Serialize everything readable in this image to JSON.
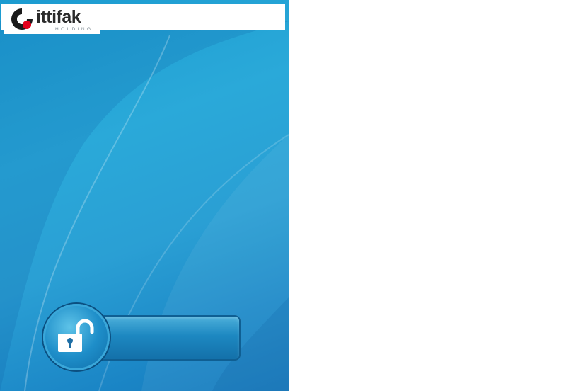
{
  "logo": {
    "wordmark": "ittifak",
    "subtitle": "HOLDING",
    "colors": {
      "mark": "#1a1a1a",
      "dot": "#e3001b"
    }
  },
  "header": {
    "title": ""
  },
  "unlock": {
    "label": "",
    "icon": "unlocked-padlock-icon"
  },
  "colors": {
    "background": "#2aa6d8",
    "slider": "#1d88c1",
    "page": "#ffffff"
  }
}
